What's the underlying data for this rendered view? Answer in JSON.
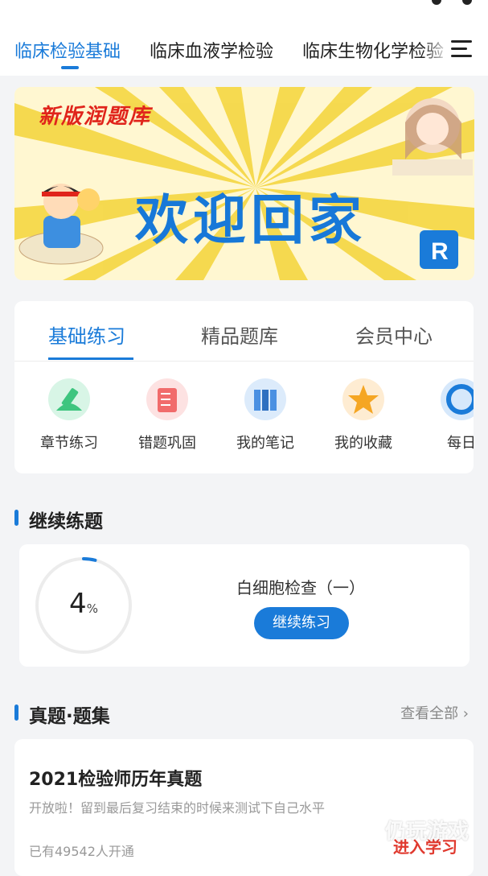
{
  "topnav": {
    "tabs": [
      "临床检验基础",
      "临床血液学检验",
      "临床生物化学检验"
    ],
    "active_index": 0
  },
  "banner": {
    "tag": "新版润题库",
    "headline": "欢迎回家"
  },
  "practice": {
    "tabs": [
      "基础练习",
      "精品题库",
      "会员中心"
    ],
    "active_index": 0,
    "icons": [
      {
        "label": "章节练习",
        "icon": "pencil-icon",
        "color": "#3ec57f"
      },
      {
        "label": "错题巩固",
        "icon": "wrong-list-icon",
        "color": "#f16b6b"
      },
      {
        "label": "我的笔记",
        "icon": "notebooks-icon",
        "color": "#4a90e2"
      },
      {
        "label": "我的收藏",
        "icon": "star-icon",
        "color": "#f5a623"
      },
      {
        "label": "每日",
        "icon": "daily-icon",
        "color": "#1a7bd9"
      }
    ]
  },
  "continue": {
    "section_title": "继续练题",
    "progress_value": "4",
    "progress_unit": "%",
    "progress": 0.04,
    "course_name": "白细胞检查（一）",
    "button_label": "继续练习"
  },
  "exams": {
    "section_title": "真题·题集",
    "view_all": "查看全部 ›",
    "items": [
      {
        "title": "2021检验师历年真题",
        "desc": "开放啦！留到最后复习结束的时候来测试下自己水平",
        "count": "已有49542人开通",
        "action": "进入学习"
      }
    ]
  },
  "watermark": "仍玩游戏",
  "colors": {
    "accent": "#1a7bd9",
    "danger": "#e03a2f",
    "background": "#f3f4f6"
  }
}
